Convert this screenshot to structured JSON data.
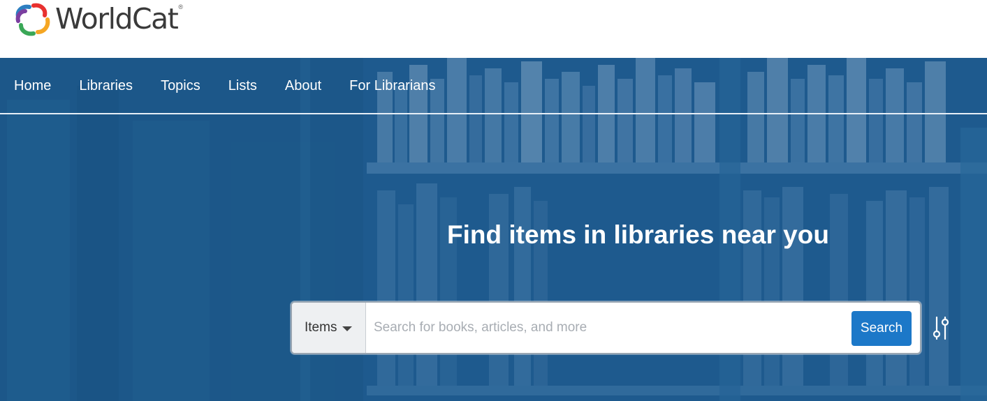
{
  "brand": {
    "name": "WorldCat",
    "reg_mark": "®",
    "logo_colors": [
      "#2d7fc1",
      "#e8312f",
      "#f5a623",
      "#3aa757",
      "#7b3fa0"
    ]
  },
  "nav": {
    "items": [
      {
        "label": "Home"
      },
      {
        "label": "Libraries"
      },
      {
        "label": "Topics"
      },
      {
        "label": "Lists"
      },
      {
        "label": "About"
      },
      {
        "label": "For Librarians"
      }
    ]
  },
  "hero": {
    "title": "Find items in libraries near you",
    "background_color": "#1f5a8c"
  },
  "search": {
    "scope_label": "Items",
    "placeholder": "Search for books, articles, and more",
    "value": "",
    "button_label": "Search",
    "button_color": "#1c78c8",
    "advanced_icon": "sliders-icon"
  }
}
